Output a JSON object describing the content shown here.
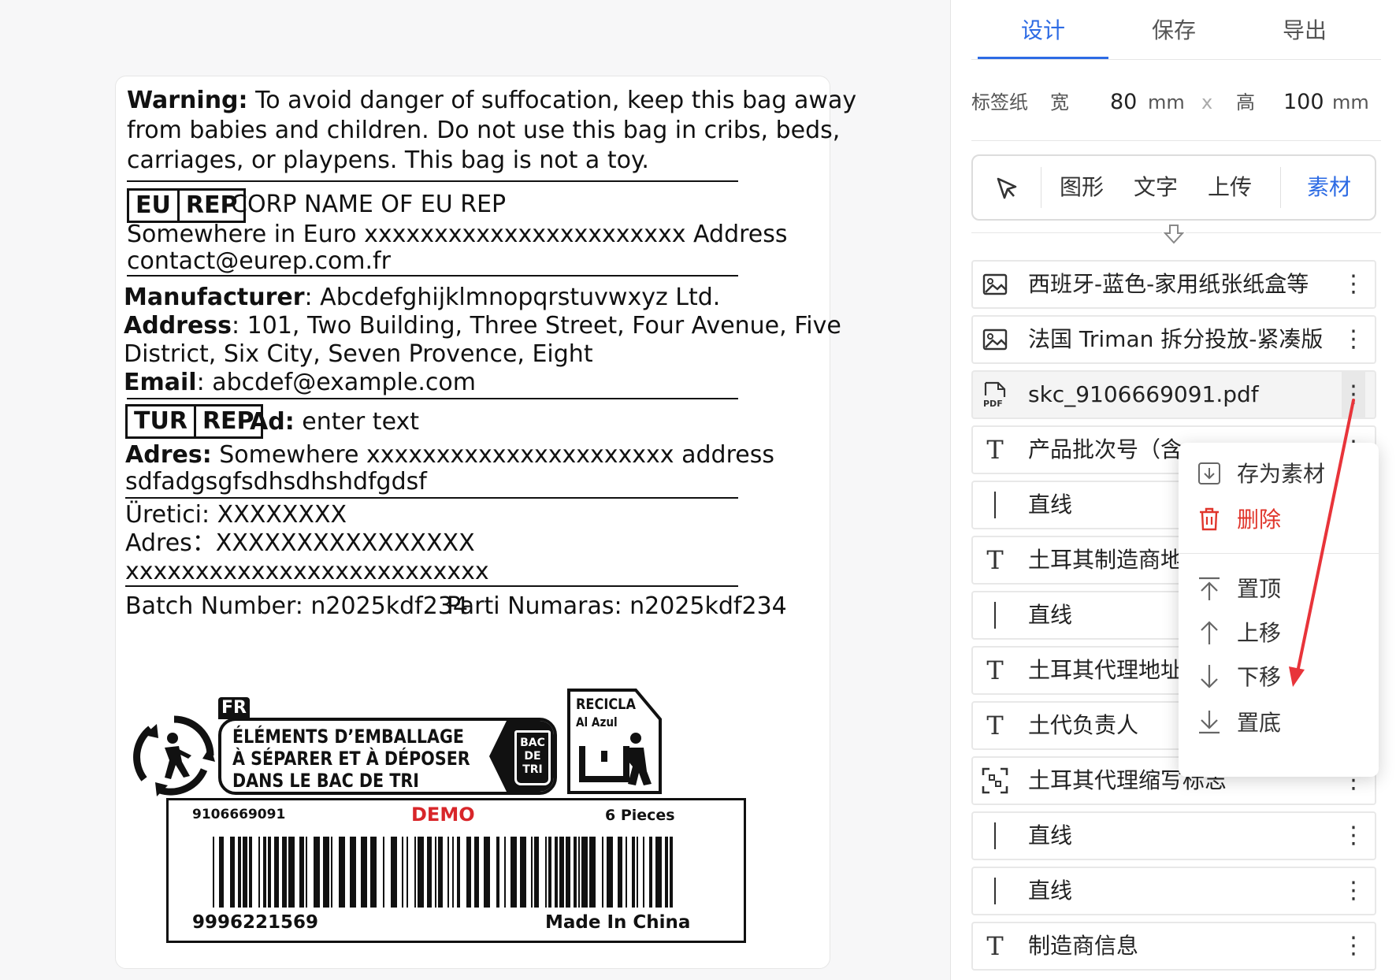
{
  "label": {
    "warning_bold": "Warning:",
    "warning_l1": " To avoid danger of suffocation, keep this bag away",
    "warning_l2": "from babies and children. Do not use this bag in cribs, beds,",
    "warning_l3": "carriages, or playpens. This bag is not a toy.",
    "eu_box_a": "EU",
    "eu_box_b": "REP",
    "eu_name": "CORP NAME OF EU REP",
    "eu_addr": "Somewhere in Euro xxxxxxxxxxxxxxxxxxxxxxx Address",
    "eu_email": "contact@eurep.com.fr",
    "mfr_label": "Manufacturer",
    "mfr_value": ": Abcdefghijklmnopqrstuvwxyz Ltd.",
    "addr_label": "Address",
    "addr_value_l1": ": 101, Two Building, Three Street, Four Avenue, Five",
    "addr_value_l2": "District, Six City, Seven Provence, Eight",
    "email_label": "Email",
    "email_value": ": abcdef@example.com",
    "tur_box_a": "TUR",
    "tur_box_b": "REP",
    "tur_ad_label": "Ad:",
    "tur_ad_value": " enter text",
    "tur_adres_label": "Adres:",
    "tur_adres_value": " Somewhere xxxxxxxxxxxxxxxxxxxxxx address",
    "tur_adres_l2": "sdfadgsgfsdhsdhshdfgdsf",
    "ureti": "Üretici: XXXXXXXX",
    "adres2": "Adres：XXXXXXXXXXXXXXXX",
    "adres3": "xxxxxxxxxxxxxxxxxxxxxxxxxx",
    "batch": "Batch Number: n2025kdf234",
    "parti": "Parti Numaras: n2025kdf234",
    "fr_tag": "FR",
    "fr_l1": "ÉLÉMENTS D’EMBALLAGE",
    "fr_l2": "À SÉPARER ET À DÉPOSER",
    "fr_l3": "DANS LE BAC DE TRI",
    "fr_bin": "BAC DE TRI",
    "recicla_l1": "RECICLA",
    "recicla_l2": "Al Azul",
    "barcode": {
      "top_left": "9106669091",
      "demo": "DEMO",
      "pieces": "6 Pieces",
      "bottom_left": "9996221569",
      "made_in": "Made In China"
    }
  },
  "panel": {
    "tabs": [
      "设计",
      "保存",
      "导出"
    ],
    "size": {
      "paper_label": "标签纸",
      "width_label": "宽",
      "width_value": "80",
      "unit": "mm",
      "times": "x",
      "height_label": "高",
      "height_value": "100",
      "unit2": "mm"
    },
    "tools": [
      "图形",
      "文字",
      "上传",
      "素材"
    ],
    "layers": [
      {
        "icon": "image-icon",
        "name": "西班牙-蓝色-家用纸张纸盒等"
      },
      {
        "icon": "image-icon",
        "name": "法国 Triman 拆分投放-紧凑版"
      },
      {
        "icon": "pdf-icon",
        "name": "skc_9106669091.pdf"
      },
      {
        "icon": "text-icon",
        "name": "产品批次号（含"
      },
      {
        "icon": "line-icon",
        "name": "直线"
      },
      {
        "icon": "text-icon",
        "name": "土耳其制造商地"
      },
      {
        "icon": "line-icon",
        "name": "直线"
      },
      {
        "icon": "text-icon",
        "name": "土耳其代理地址"
      },
      {
        "icon": "text-icon",
        "name": "土代负责人"
      },
      {
        "icon": "qr-icon",
        "name": "土耳其代理缩写标志"
      },
      {
        "icon": "line-icon",
        "name": "直线"
      },
      {
        "icon": "line-icon",
        "name": "直线"
      },
      {
        "icon": "text-icon",
        "name": "制造商信息"
      }
    ],
    "more_glyph": "⋮",
    "context_menu": [
      "存为素材",
      "删除",
      "置顶",
      "上移",
      "下移",
      "置底"
    ]
  },
  "colors": {
    "accent": "#2d6be4",
    "danger": "#e0352b",
    "annotation": "#e8343a"
  }
}
